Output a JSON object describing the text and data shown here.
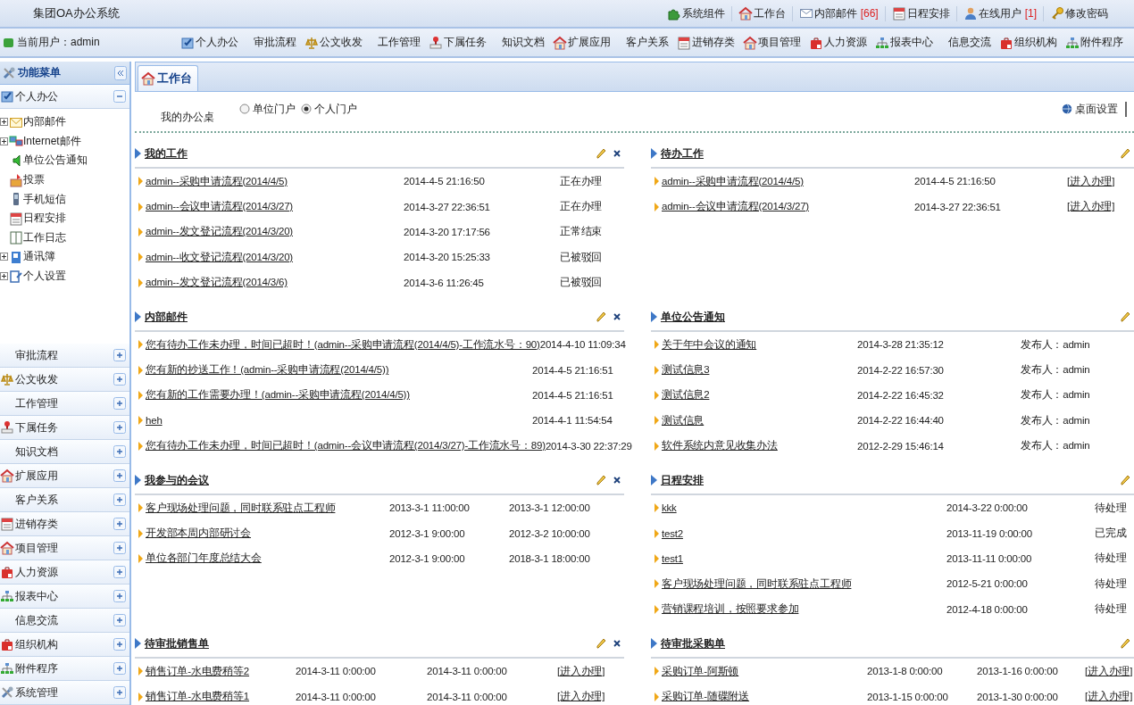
{
  "app": {
    "title": "集团OA办公系统"
  },
  "top_links": [
    {
      "label": "系统组件"
    },
    {
      "label": "工作台"
    },
    {
      "label": "内部邮件",
      "count": "[66]"
    },
    {
      "label": "日程安排"
    },
    {
      "label": "在线用户",
      "count": "[1]"
    },
    {
      "label": "修改密码"
    }
  ],
  "current_user": "当前用户：admin",
  "nav": [
    {
      "label": "个人办公",
      "has_icon": true
    },
    {
      "label": "审批流程",
      "has_icon": false
    },
    {
      "label": "公文收发",
      "has_icon": true
    },
    {
      "label": "工作管理",
      "has_icon": false
    },
    {
      "label": "下属任务",
      "has_icon": true
    },
    {
      "label": "知识文档",
      "has_icon": false
    },
    {
      "label": "扩展应用",
      "has_icon": true
    },
    {
      "label": "客户关系",
      "has_icon": false
    },
    {
      "label": "进销存类",
      "has_icon": true
    },
    {
      "label": "项目管理",
      "has_icon": true
    },
    {
      "label": "人力资源",
      "has_icon": true
    },
    {
      "label": "报表中心",
      "has_icon": true
    },
    {
      "label": "信息交流",
      "has_icon": false
    },
    {
      "label": "组织机构",
      "has_icon": true
    },
    {
      "label": "附件程序",
      "has_icon": true
    }
  ],
  "sidebar": {
    "title": "功能菜单",
    "groups": [
      {
        "label": "个人办公",
        "has_icon": true,
        "expanded": true,
        "items": [
          {
            "label": "内部邮件",
            "kind": "folder"
          },
          {
            "label": "Internet邮件",
            "kind": "folder"
          },
          {
            "label": "单位公告通知",
            "kind": "leaf"
          },
          {
            "label": "投票",
            "kind": "leaf"
          },
          {
            "label": "手机短信",
            "kind": "leaf"
          },
          {
            "label": "日程安排",
            "kind": "leaf"
          },
          {
            "label": "工作日志",
            "kind": "leaf"
          },
          {
            "label": "通讯簿",
            "kind": "folder"
          },
          {
            "label": "个人设置",
            "kind": "folder"
          }
        ]
      },
      {
        "label": "审批流程",
        "has_icon": false,
        "expanded": false
      },
      {
        "label": "公文收发",
        "has_icon": true,
        "expanded": false
      },
      {
        "label": "工作管理",
        "has_icon": false,
        "expanded": false
      },
      {
        "label": "下属任务",
        "has_icon": true,
        "expanded": false
      },
      {
        "label": "知识文档",
        "has_icon": false,
        "expanded": false
      },
      {
        "label": "扩展应用",
        "has_icon": true,
        "expanded": false
      },
      {
        "label": "客户关系",
        "has_icon": false,
        "expanded": false
      },
      {
        "label": "进销存类",
        "has_icon": true,
        "expanded": false
      },
      {
        "label": "项目管理",
        "has_icon": true,
        "expanded": false
      },
      {
        "label": "人力资源",
        "has_icon": true,
        "expanded": false
      },
      {
        "label": "报表中心",
        "has_icon": true,
        "expanded": false
      },
      {
        "label": "信息交流",
        "has_icon": false,
        "expanded": false
      },
      {
        "label": "组织机构",
        "has_icon": true,
        "expanded": false
      },
      {
        "label": "附件程序",
        "has_icon": true,
        "expanded": false
      },
      {
        "label": "系统管理",
        "has_icon": true,
        "expanded": false
      }
    ]
  },
  "tabs": [
    {
      "label": "工作台",
      "selected": true
    }
  ],
  "desk": {
    "title": "我的办公桌",
    "portals": [
      {
        "label": "单位门户",
        "selected": false
      },
      {
        "label": "个人门户",
        "selected": true
      }
    ],
    "settings": "桌面设置"
  },
  "panels": [
    {
      "title": "我的工作",
      "kind": "work",
      "closable": true,
      "rows": [
        [
          "admin--采购申请流程(2014/4/5)",
          "2014-4-5 21:16:50",
          "正在办理"
        ],
        [
          "admin--会议申请流程(2014/3/27)",
          "2014-3-27 22:36:51",
          "正在办理"
        ],
        [
          "admin--发文登记流程(2014/3/20)",
          "2014-3-20 17:17:56",
          "正常结束"
        ],
        [
          "admin--收文登记流程(2014/3/20)",
          "2014-3-20 15:25:33",
          "已被驳回"
        ],
        [
          "admin--发文登记流程(2014/3/6)",
          "2014-3-6 11:26:45",
          "已被驳回"
        ]
      ]
    },
    {
      "title": "待办工作",
      "kind": "pending",
      "closable": false,
      "rows": [
        [
          "admin--采购申请流程(2014/4/5)",
          "2014-4-5 21:16:50",
          "[进入办理]"
        ],
        [
          "admin--会议申请流程(2014/3/27)",
          "2014-3-27 22:36:51",
          "[进入办理]"
        ]
      ]
    },
    {
      "title": "内部邮件",
      "kind": "mail",
      "closable": true,
      "rows": [
        [
          "您有待办工作未办理，时间已超时！(admin--采购申请流程(2014/4/5)-工作流水号：90)",
          "2014-4-10 11:09:34"
        ],
        [
          "您有新的抄送工作！(admin--采购申请流程(2014/4/5))",
          "2014-4-5 21:16:51"
        ],
        [
          "您有新的工作需要办理！(admin--采购申请流程(2014/4/5))",
          "2014-4-5 21:16:51"
        ],
        [
          "heh",
          "2014-4-1 11:54:54"
        ],
        [
          "您有待办工作未办理，时间已超时！(admin--会议申请流程(2014/3/27)-工作流水号：89)",
          "2014-3-30 22:37:29"
        ]
      ]
    },
    {
      "title": "单位公告通知",
      "kind": "notice",
      "closable": false,
      "rows": [
        [
          "关于年中会议的通知",
          "2014-3-28 21:35:12",
          "发布人：admin"
        ],
        [
          "测试信息3",
          "2014-2-22 16:57:30",
          "发布人：admin"
        ],
        [
          "测试信息2",
          "2014-2-22 16:45:32",
          "发布人：admin"
        ],
        [
          "测试信息",
          "2014-2-22 16:44:40",
          "发布人：admin"
        ],
        [
          "软件系统内意见收集办法",
          "2012-2-29 15:46:14",
          "发布人：admin"
        ]
      ]
    },
    {
      "title": "我参与的会议",
      "kind": "meeting",
      "closable": true,
      "rows": [
        [
          "客户现场处理问题，同时联系驻点工程师",
          "2013-3-1 11:00:00",
          "2013-3-1 12:00:00"
        ],
        [
          "开发部本周内部研讨会",
          "2012-3-1 9:00:00",
          "2012-3-2 10:00:00"
        ],
        [
          "单位各部门年度总结大会",
          "2012-3-1 9:00:00",
          "2018-3-1 18:00:00"
        ]
      ]
    },
    {
      "title": "日程安排",
      "kind": "schedule",
      "closable": false,
      "rows": [
        [
          "kkk",
          "2014-3-22 0:00:00",
          "待处理"
        ],
        [
          "test2",
          "2013-11-19 0:00:00",
          "已完成"
        ],
        [
          "test1",
          "2013-11-11 0:00:00",
          "待处理"
        ],
        [
          "客户现场处理问题，同时联系驻点工程师",
          "2012-5-21 0:00:00",
          "待处理"
        ],
        [
          "营销课程培训，按照要求参加",
          "2012-4-18 0:00:00",
          "待处理"
        ]
      ]
    },
    {
      "title": "待审批销售单",
      "kind": "sales",
      "closable": true,
      "rows": [
        [
          "销售订单-水电费稍等2",
          "2014-3-11 0:00:00",
          "2014-3-11 0:00:00",
          "[进入办理]"
        ],
        [
          "销售订单-水电费稍等1",
          "2014-3-11 0:00:00",
          "2014-3-11 0:00:00",
          "[进入办理]"
        ]
      ]
    },
    {
      "title": "待审批采购单",
      "kind": "purchase",
      "closable": false,
      "rows": [
        [
          "采购订单-阿斯顿",
          "2013-1-8 0:00:00",
          "2013-1-16 0:00:00",
          "[进入办理]"
        ],
        [
          "采购订单-随碟附送",
          "2013-1-15 0:00:00",
          "2013-1-30 0:00:00",
          "[进入办理]"
        ]
      ]
    }
  ]
}
